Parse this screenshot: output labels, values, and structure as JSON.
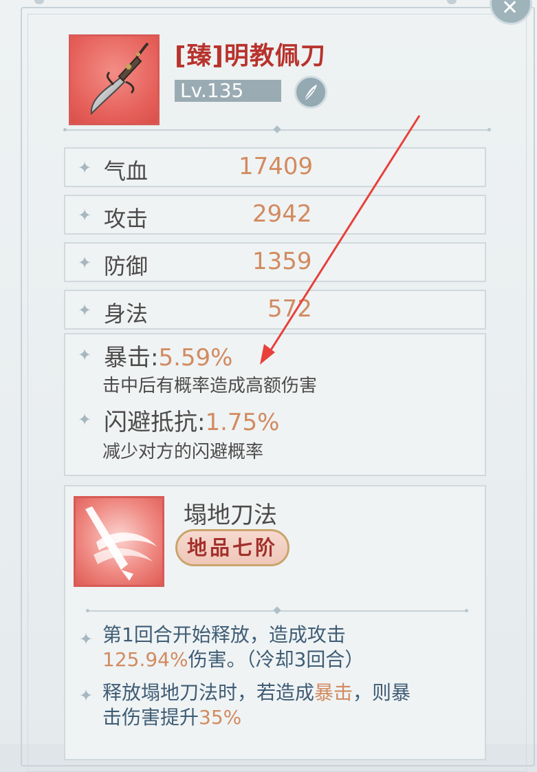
{
  "item": {
    "title": "[臻]明教佩刀",
    "level": "Lv.135",
    "icon": "dagger-icon",
    "type_icon": "feather-icon"
  },
  "stats": [
    {
      "name": "气血",
      "value": "17409"
    },
    {
      "name": "攻击",
      "value": "2942"
    },
    {
      "name": "防御",
      "value": "1359"
    },
    {
      "name": "身法",
      "value": "572"
    }
  ],
  "special_attrs": [
    {
      "name": "暴击",
      "sep": ":",
      "value": "5.59%",
      "desc": "击中后有概率造成高额伤害"
    },
    {
      "name": "闪避抵抗",
      "sep": ":",
      "value": "1.75%",
      "desc": "减少对方的闪避概率"
    }
  ],
  "skill": {
    "name": "塌地刀法",
    "grade": "地品七阶",
    "icon": "sword-slash-icon",
    "effect1_line1": "第1回合开始释放，造成攻击",
    "effect1_line2_value": "125.94%",
    "effect1_line2_rest": "伤害。（冷却3回合）",
    "effect2_line1_a": "释放塌地刀法时，若造成",
    "effect2_line1_hl": "暴击",
    "effect2_line1_b": "，则暴",
    "effect2_line2_a": "击伤害提升",
    "effect2_line2_hl": "35%"
  },
  "colors": {
    "value_orange": "#d28a5f",
    "title_red": "#b8332d",
    "annotation_arrow": "#e8403a"
  },
  "close_icon": "close-x-icon"
}
